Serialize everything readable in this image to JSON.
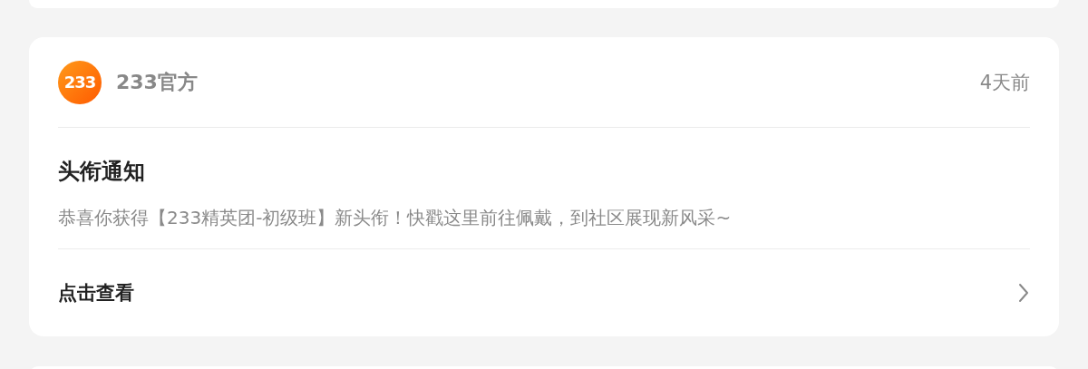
{
  "message": {
    "sender": {
      "logo_text": "233",
      "name": "233官方"
    },
    "time": "4天前",
    "title": "头衔通知",
    "body": "恭喜你获得【233精英团-初级班】新头衔！快戳这里前往佩戴，到社区展现新风采~",
    "action": "点击查看"
  }
}
